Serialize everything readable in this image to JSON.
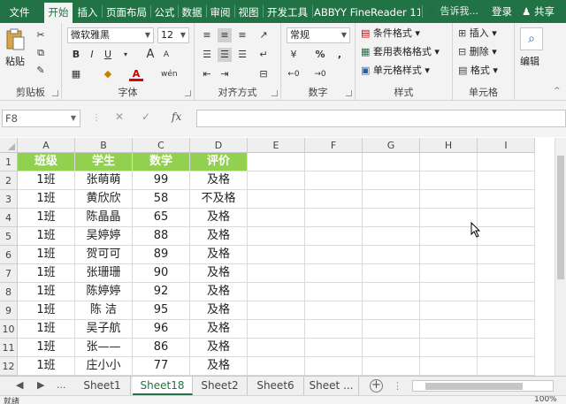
{
  "ribbon_tabs": [
    "文件",
    "开始",
    "插入",
    "页面布局",
    "公式",
    "数据",
    "审阅",
    "视图",
    "开发工具",
    "ABBYY FineReader 11"
  ],
  "active_tab": "开始",
  "tell_me": "告诉我...",
  "login": "登录",
  "share": "共享",
  "clipboard": {
    "paste": "粘贴",
    "label": "剪贴板"
  },
  "font": {
    "name": "微软雅黑",
    "size": "12",
    "label": "字体",
    "bold": "B",
    "italic": "I",
    "underline": "U",
    "grow": "A",
    "shrink": "A",
    "wen": "wén"
  },
  "alignment": {
    "label": "对齐方式"
  },
  "number": {
    "format": "常规",
    "label": "数字",
    "percent": "%",
    "comma": ","
  },
  "styles": {
    "conditional": "条件格式",
    "table": "套用表格格式",
    "cell": "单元格样式",
    "label": "样式"
  },
  "cells": {
    "insert": "插入",
    "delete": "删除",
    "format": "格式",
    "label": "单元格"
  },
  "editing": {
    "label": "编辑"
  },
  "formula_bar": {
    "name_box": "F8",
    "cancel": "✕",
    "enter": "✓",
    "fx": "fx",
    "value": ""
  },
  "columns": [
    "A",
    "B",
    "C",
    "D",
    "E",
    "F",
    "G",
    "H",
    "I"
  ],
  "rows": [
    "1",
    "2",
    "3",
    "4",
    "5",
    "6",
    "7",
    "8",
    "9",
    "10",
    "11",
    "12"
  ],
  "table": {
    "headers": [
      "班级",
      "学生",
      "数学",
      "评价"
    ],
    "rows": [
      [
        "1班",
        "张萌萌",
        "99",
        "及格"
      ],
      [
        "1班",
        "黄欣欣",
        "58",
        "不及格"
      ],
      [
        "1班",
        "陈晶晶",
        "65",
        "及格"
      ],
      [
        "1班",
        "吴婷婷",
        "88",
        "及格"
      ],
      [
        "1班",
        "贺可可",
        "89",
        "及格"
      ],
      [
        "1班",
        "张珊珊",
        "90",
        "及格"
      ],
      [
        "1班",
        "陈婷婷",
        "92",
        "及格"
      ],
      [
        "1班",
        "陈  洁",
        "95",
        "及格"
      ],
      [
        "1班",
        "吴子航",
        "96",
        "及格"
      ],
      [
        "1班",
        "张——",
        "86",
        "及格"
      ],
      [
        "1班",
        "庄小小",
        "77",
        "及格"
      ]
    ]
  },
  "sheet_tabs": [
    "Sheet1",
    "Sheet18",
    "Sheet2",
    "Sheet6",
    "Sheet ..."
  ],
  "active_sheet": "Sheet18",
  "nav": {
    "prev": "◀",
    "next": "▶",
    "more": "..."
  },
  "status": {
    "ready": "就绪",
    "zoom": "100%"
  },
  "colors": {
    "accent": "#217346",
    "header_fill": "#92d050"
  }
}
